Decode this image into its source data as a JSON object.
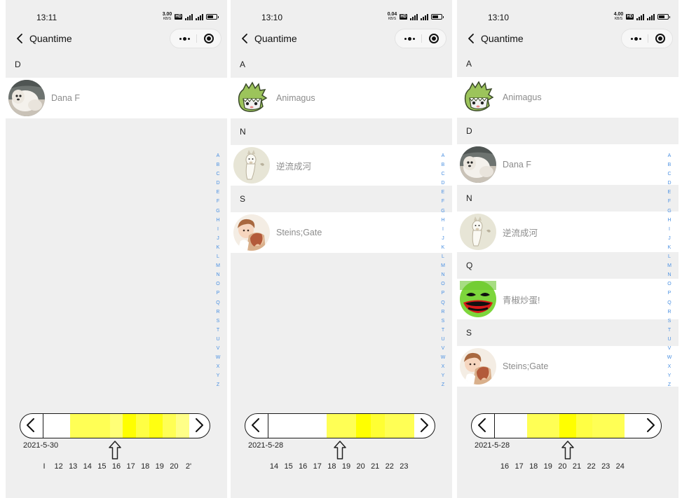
{
  "panels": [
    {
      "status_time": "13:11",
      "net_speed": "3.00",
      "net_unit": "KB/S",
      "title": "Quantime",
      "sections": [
        {
          "letter": "D",
          "contacts": [
            {
              "name": "Dana F",
              "avatar": "dog-avatar"
            }
          ]
        }
      ],
      "index_letters": [
        "A",
        "B",
        "C",
        "D",
        "E",
        "F",
        "G",
        "H",
        "I",
        "J",
        "K",
        "L",
        "M",
        "N",
        "O",
        "P",
        "Q",
        "R",
        "S",
        "T",
        "U",
        "V",
        "W",
        "X",
        "Y",
        "Z"
      ],
      "timeline": {
        "date": "2021-5-30",
        "days": [
          "I",
          "12",
          "13",
          "14",
          "15",
          "16",
          "17",
          "18",
          "19",
          "20",
          "2'"
        ],
        "levels": [
          0,
          0,
          0.5,
          0.5,
          0.5,
          0.3,
          1,
          0.6,
          0.9,
          0.5,
          0.2
        ]
      }
    },
    {
      "status_time": "13:10",
      "net_speed": "0.04",
      "net_unit": "KB/S",
      "title": "Quantime",
      "sections": [
        {
          "letter": "A",
          "contacts": [
            {
              "name": "Animagus",
              "avatar": "dino-avatar"
            }
          ]
        },
        {
          "letter": "N",
          "contacts": [
            {
              "name": "逆流成河",
              "avatar": "alpaca-avatar"
            }
          ]
        },
        {
          "letter": "S",
          "contacts": [
            {
              "name": "Steins;Gate",
              "avatar": "anime-avatar"
            }
          ]
        }
      ],
      "index_letters": [
        "A",
        "B",
        "C",
        "D",
        "E",
        "F",
        "G",
        "H",
        "I",
        "J",
        "K",
        "L",
        "M",
        "N",
        "O",
        "P",
        "Q",
        "R",
        "S",
        "T",
        "U",
        "V",
        "W",
        "X",
        "Y",
        "Z"
      ],
      "timeline": {
        "date": "2021-5-28",
        "days": [
          "14",
          "15",
          "16",
          "17",
          "18",
          "19",
          "20",
          "21",
          "22",
          "23"
        ],
        "levels": [
          0,
          0,
          0,
          0,
          0.5,
          0.5,
          1,
          0.7,
          0.5,
          0.5
        ]
      }
    },
    {
      "status_time": "13:10",
      "net_speed": "4.00",
      "net_unit": "KB/S",
      "title": "Quantime",
      "sections": [
        {
          "letter": "A",
          "contacts": [
            {
              "name": "Animagus",
              "avatar": "dino-avatar"
            }
          ]
        },
        {
          "letter": "D",
          "contacts": [
            {
              "name": "Dana F",
              "avatar": "dog-avatar"
            }
          ]
        },
        {
          "letter": "N",
          "contacts": [
            {
              "name": "逆流成河",
              "avatar": "alpaca-avatar"
            }
          ]
        },
        {
          "letter": "Q",
          "contacts": [
            {
              "name": "青椒炒蛋!",
              "avatar": "green-face-avatar"
            }
          ]
        },
        {
          "letter": "S",
          "contacts": [
            {
              "name": "Steins;Gate",
              "avatar": "anime-avatar"
            }
          ]
        }
      ],
      "index_letters": [
        "A",
        "B",
        "C",
        "D",
        "E",
        "F",
        "G",
        "H",
        "I",
        "J",
        "K",
        "L",
        "M",
        "N",
        "O",
        "P",
        "Q",
        "R",
        "S",
        "T",
        "U",
        "V",
        "W",
        "X",
        "Y",
        "Z"
      ],
      "timeline": {
        "date": "2021-5-28",
        "days": [
          "16",
          "17",
          "18",
          "19",
          "20",
          "21",
          "22",
          "23",
          "24"
        ],
        "levels": [
          0,
          0,
          0.5,
          0.5,
          1,
          0.6,
          0.5,
          0.5,
          0
        ]
      }
    }
  ],
  "colors": {
    "background": "#efefef",
    "row": "#ffffff",
    "name": "#8c8c8c",
    "index": "#4a90e2",
    "heat_low": "#ffffaa",
    "heat_high": "#ffff00"
  }
}
